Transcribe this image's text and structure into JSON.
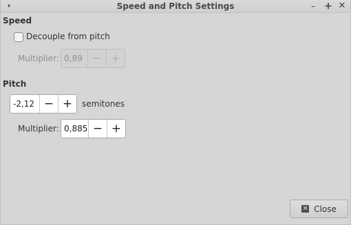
{
  "window": {
    "title": "Speed and Pitch Settings",
    "menu_glyph": "▾",
    "minimize_glyph": "–",
    "maximize_glyph": "+",
    "close_glyph": "✕"
  },
  "speed": {
    "section_title": "Speed",
    "decouple_label": "Decouple from pitch",
    "decouple_checked": false,
    "multiplier_label": "Multiplier:",
    "multiplier_value": "0,89",
    "minus_glyph": "−",
    "plus_glyph": "+"
  },
  "pitch": {
    "section_title": "Pitch",
    "semitones_value": "-2,12",
    "semitones_label": "semitones",
    "multiplier_label": "Multiplier:",
    "multiplier_value": "0,885",
    "minus_glyph": "−",
    "plus_glyph": "+"
  },
  "footer": {
    "close_label": "Close",
    "close_icon_glyph": "✕"
  }
}
